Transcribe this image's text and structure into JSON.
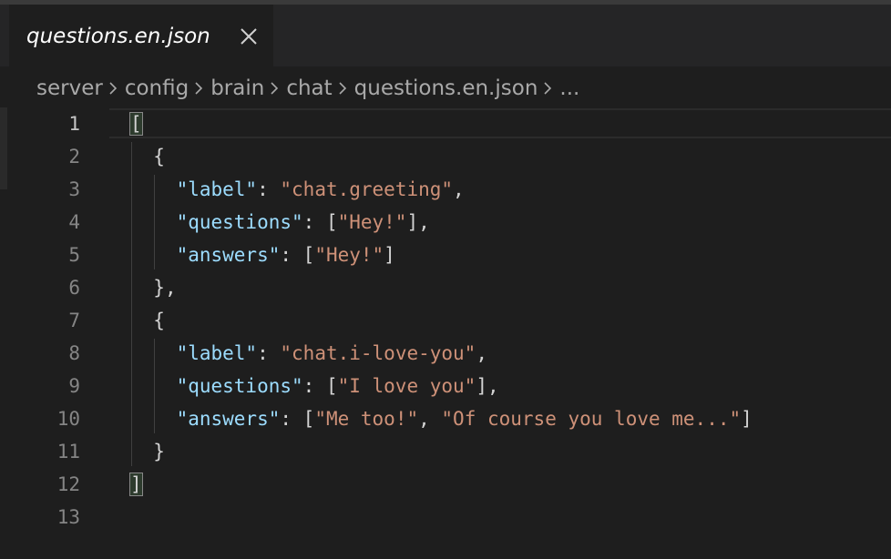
{
  "tab": {
    "title": "questions.en.json"
  },
  "breadcrumb": {
    "items": [
      "server",
      "config",
      "brain",
      "chat",
      "questions.en.json",
      "..."
    ]
  },
  "editor": {
    "active_line": 1,
    "lines": [
      {
        "n": "1",
        "indent": "",
        "tokens": [
          {
            "t": "p",
            "v": "["
          }
        ]
      },
      {
        "n": "2",
        "indent": "  ",
        "tokens": [
          {
            "t": "p",
            "v": "{"
          }
        ]
      },
      {
        "n": "3",
        "indent": "    ",
        "tokens": [
          {
            "t": "k",
            "v": "\"label\""
          },
          {
            "t": "p",
            "v": ": "
          },
          {
            "t": "s",
            "v": "\"chat.greeting\""
          },
          {
            "t": "p",
            "v": ","
          }
        ]
      },
      {
        "n": "4",
        "indent": "    ",
        "tokens": [
          {
            "t": "k",
            "v": "\"questions\""
          },
          {
            "t": "p",
            "v": ": ["
          },
          {
            "t": "s",
            "v": "\"Hey!\""
          },
          {
            "t": "p",
            "v": "],"
          }
        ]
      },
      {
        "n": "5",
        "indent": "    ",
        "tokens": [
          {
            "t": "k",
            "v": "\"answers\""
          },
          {
            "t": "p",
            "v": ": ["
          },
          {
            "t": "s",
            "v": "\"Hey!\""
          },
          {
            "t": "p",
            "v": "]"
          }
        ]
      },
      {
        "n": "6",
        "indent": "  ",
        "tokens": [
          {
            "t": "p",
            "v": "},"
          }
        ]
      },
      {
        "n": "7",
        "indent": "  ",
        "tokens": [
          {
            "t": "p",
            "v": "{"
          }
        ]
      },
      {
        "n": "8",
        "indent": "    ",
        "tokens": [
          {
            "t": "k",
            "v": "\"label\""
          },
          {
            "t": "p",
            "v": ": "
          },
          {
            "t": "s",
            "v": "\"chat.i-love-you\""
          },
          {
            "t": "p",
            "v": ","
          }
        ]
      },
      {
        "n": "9",
        "indent": "    ",
        "tokens": [
          {
            "t": "k",
            "v": "\"questions\""
          },
          {
            "t": "p",
            "v": ": ["
          },
          {
            "t": "s",
            "v": "\"I love you\""
          },
          {
            "t": "p",
            "v": "],"
          }
        ]
      },
      {
        "n": "10",
        "indent": "    ",
        "tokens": [
          {
            "t": "k",
            "v": "\"answers\""
          },
          {
            "t": "p",
            "v": ": ["
          },
          {
            "t": "s",
            "v": "\"Me too!\""
          },
          {
            "t": "p",
            "v": ", "
          },
          {
            "t": "s",
            "v": "\"Of course you love me...\""
          },
          {
            "t": "p",
            "v": "]"
          }
        ]
      },
      {
        "n": "11",
        "indent": "  ",
        "tokens": [
          {
            "t": "p",
            "v": "}"
          }
        ]
      },
      {
        "n": "12",
        "indent": "",
        "tokens": [
          {
            "t": "p",
            "v": "]"
          }
        ]
      },
      {
        "n": "13",
        "indent": "",
        "tokens": []
      }
    ]
  },
  "theme": {
    "background": "#1e1e1e",
    "key_color": "#9cdcfe",
    "string_color": "#ce9178",
    "punctuation_color": "#d4d4d4",
    "line_number_color": "#858585"
  }
}
